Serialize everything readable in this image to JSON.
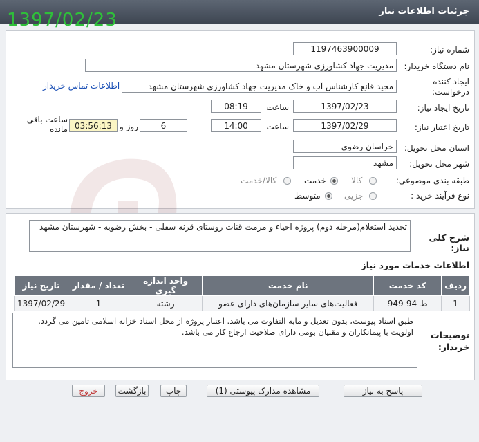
{
  "window": {
    "title": "جزئیات اطلاعات نیاز"
  },
  "stamp": {
    "date": "1397/02/23"
  },
  "form": {
    "need_number_label": "شماره نیاز:",
    "need_number": "1197463900009",
    "buyer_org_label": "نام دستگاه خریدار:",
    "buyer_org": "مدیریت جهاد کشاورزی شهرستان مشهد",
    "creator_label": "ایجاد کننده درخواست:",
    "creator": "مجید قانع کارشناس آب و خاک مدیریت جهاد کشاورزی شهرستان مشهد",
    "contact_link": "اطلاعات تماس خریدار",
    "announce_date_label": "تاریخ ایجاد نیاز:",
    "announce_date": "1397/02/23",
    "time_label": "ساعت",
    "announce_time": "08:19",
    "validity_label": "تاریخ اعتبار نیاز:",
    "validity_date": "1397/02/29",
    "validity_time": "14:00",
    "days": "6",
    "days_label": "روز و",
    "remaining": "03:56:13",
    "remaining_label": "ساعت باقی مانده",
    "province_label": "استان محل تحویل:",
    "province": "خراسان رضوی",
    "city_label": "شهر محل تحویل:",
    "city": "مشهد",
    "category_label": "طبقه بندی موضوعی:",
    "category_options": [
      "کالا",
      "خدمت",
      "کالا/خدمت"
    ],
    "category_selected": "خدمت",
    "process_label": "نوع فرآیند خرید :",
    "process_options": [
      "جزیی",
      "متوسط"
    ],
    "process_selected": "متوسط"
  },
  "summary": {
    "label": "شرح کلی نیاز:",
    "text": "تجدید استعلام(مرحله دوم) پروژه احیاء و مرمت قنات روستای قرنه سفلی - بخش رضویه - شهرستان مشهد"
  },
  "services": {
    "title": "اطلاعات خدمات مورد نیاز",
    "headers": [
      "ردیف",
      "کد خدمت",
      "نام خدمت",
      "واحد اندازه گیری",
      "تعداد / مقدار",
      "تاریخ نیاز"
    ],
    "rows": [
      [
        "1",
        "ط-94-949",
        "فعالیت‌های سایر سازمان‌های دارای عضو",
        "رشته",
        "1",
        "1397/02/29"
      ]
    ]
  },
  "notes": {
    "label": "توضیحات خریدار:",
    "text": "طبق اسناد پیوست، بدون تعدیل و مابه التفاوت می باشد. اعتبار پروژه از محل اسناد خزانه اسلامی تامین می گردد. اولویت با پیمانکاران و مقنیان بومی دارای صلاحیت ارجاع کار می باشد."
  },
  "buttons": {
    "reply": "پاسخ به نیاز",
    "attachments": "مشاهده مدارک پیوستی (1)",
    "print": "چاپ",
    "back": "بازگشت",
    "exit": "خروج"
  }
}
